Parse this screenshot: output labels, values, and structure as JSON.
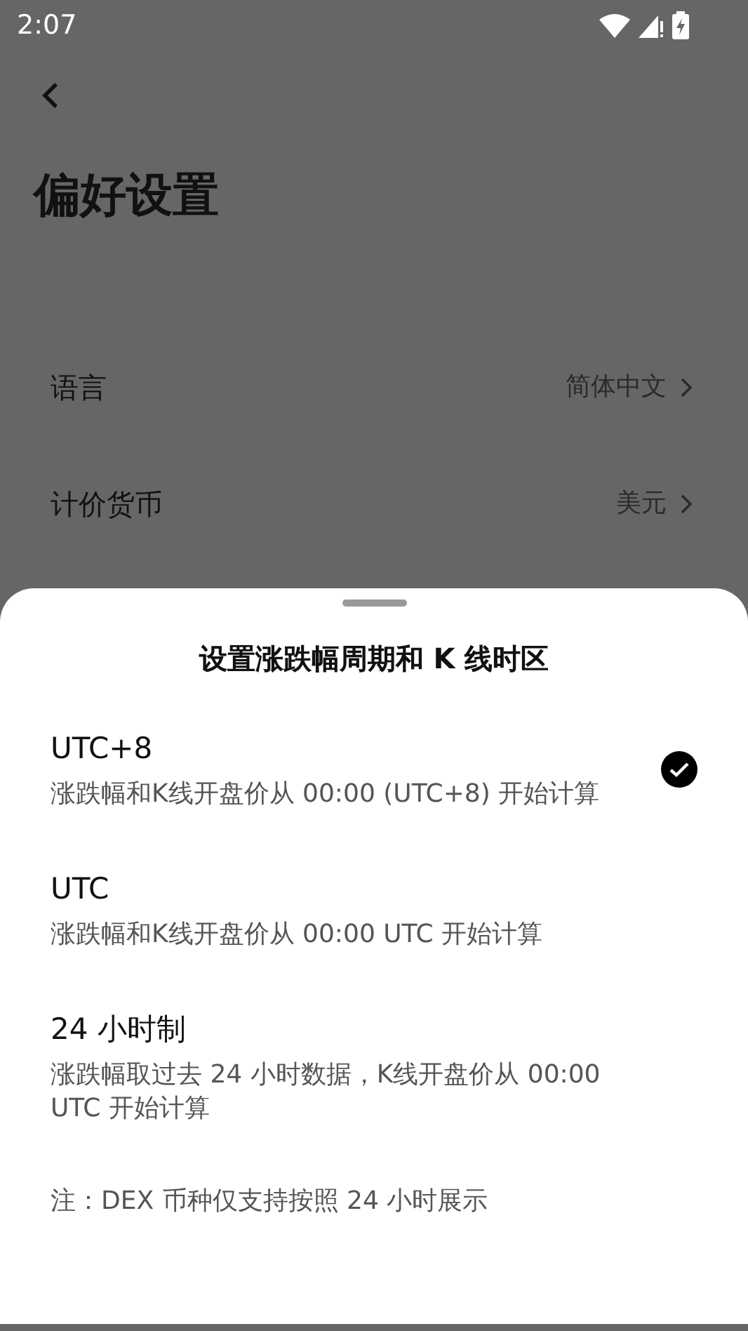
{
  "status_bar": {
    "time": "2:07"
  },
  "page": {
    "title": "偏好设置"
  },
  "settings": [
    {
      "label": "语言",
      "value": "简体中文"
    },
    {
      "label": "计价货币",
      "value": "美元"
    }
  ],
  "sheet": {
    "title": "设置涨跌幅周期和 K 线时区",
    "options": [
      {
        "title": "UTC+8",
        "description": "涨跌幅和K线开盘价从 00:00 (UTC+8) 开始计算",
        "selected": true
      },
      {
        "title": "UTC",
        "description": "涨跌幅和K线开盘价从 00:00 UTC 开始计算",
        "selected": false
      },
      {
        "title": "24 小时制",
        "description": "涨跌幅取过去 24 小时数据，K线开盘价从 00:00 UTC 开始计算",
        "selected": false
      }
    ],
    "note": "注：DEX 币种仅支持按照 24 小时展示"
  }
}
